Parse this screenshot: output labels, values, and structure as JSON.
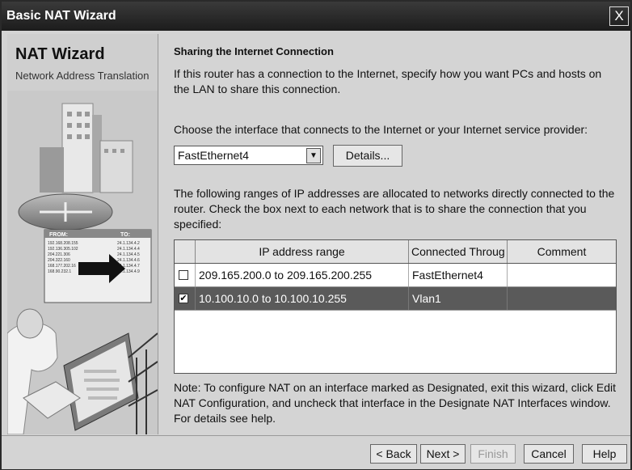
{
  "window": {
    "title": "Basic NAT Wizard",
    "close_glyph": "X"
  },
  "left_panel": {
    "heading": "NAT Wizard",
    "subheading": "Network Address Translation",
    "illustration": {
      "table_header_from": "FROM:",
      "table_header_to": "TO:",
      "from_rows": [
        "192.168.208.155",
        "192.136.305.102",
        "204.221.306",
        "204.322.160",
        "168.177.202.16",
        "168.90.232.1"
      ],
      "to_rows": [
        "24.1.134.4.2",
        "24.1.134.4.4",
        "24.1.134.4.5",
        "24.1.134.4.6",
        "24.1.134.4.7",
        "24.1.134.4.9"
      ]
    }
  },
  "content": {
    "section_title": "Sharing the Internet Connection",
    "intro_text": "If this router has a connection to the Internet, specify how you want PCs and hosts on the LAN to share this connection.",
    "choose_label": "Choose the interface that connects to the Internet or your Internet service provider:",
    "interface_select": {
      "value": "FastEthernet4"
    },
    "details_button": "Details...",
    "ranges_text": "The following ranges of IP addresses are allocated to networks directly connected to the router. Check the box next to each network that is to share the connection that you specified:",
    "table": {
      "columns": [
        "IP address range",
        "Connected Throug",
        "Comment"
      ],
      "rows": [
        {
          "checked": false,
          "range": "209.165.200.0 to 209.165.200.255",
          "connected": "FastEthernet4",
          "comment": ""
        },
        {
          "checked": true,
          "range": "10.100.10.0 to 10.100.10.255",
          "connected": "Vlan1",
          "comment": "",
          "selected": true
        }
      ]
    },
    "note_text": "Note: To configure NAT on an interface marked as Designated, exit this wizard, click Edit NAT Configuration, and uncheck that interface in the Designate NAT Interfaces window. For details see help."
  },
  "footer": {
    "back": "< Back",
    "next": "Next >",
    "finish": "Finish",
    "cancel": "Cancel",
    "help": "Help"
  },
  "check_glyph": "✔"
}
